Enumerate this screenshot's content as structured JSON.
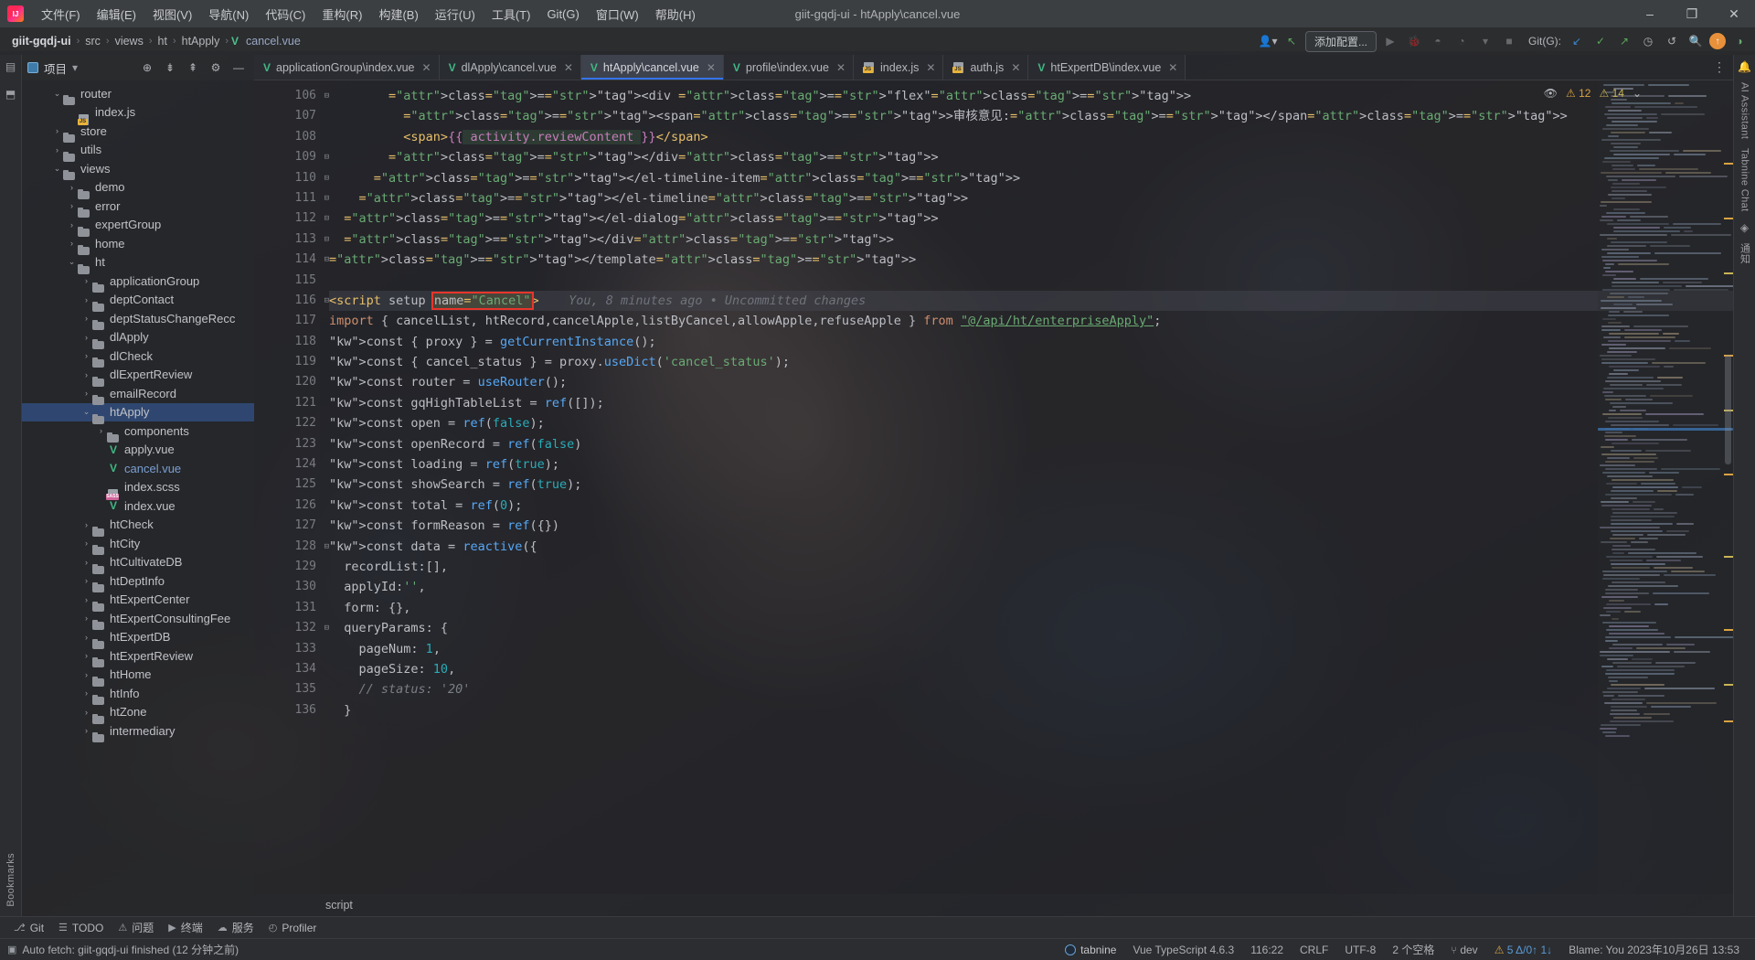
{
  "window": {
    "title": "giit-gqdj-ui - htApply\\cancel.vue",
    "minimize": "–",
    "maximize": "❐",
    "close": "✕"
  },
  "menu": [
    {
      "label": "文件(F)"
    },
    {
      "label": "编辑(E)"
    },
    {
      "label": "视图(V)"
    },
    {
      "label": "导航(N)"
    },
    {
      "label": "代码(C)"
    },
    {
      "label": "重构(R)"
    },
    {
      "label": "构建(B)"
    },
    {
      "label": "运行(U)"
    },
    {
      "label": "工具(T)"
    },
    {
      "label": "Git(G)"
    },
    {
      "label": "窗口(W)"
    },
    {
      "label": "帮助(H)"
    }
  ],
  "breadcrumbs": {
    "items": [
      "giit-gqdj-ui",
      "src",
      "views",
      "ht",
      "htApply"
    ],
    "file": "cancel.vue",
    "separator": "›"
  },
  "toolbar": {
    "run_config": "添加配置...",
    "git_label": "Git(G):",
    "profiler_dropdown": "▾"
  },
  "project_panel": {
    "title": "项目",
    "dropdown": "▾",
    "tree": [
      {
        "depth": 2,
        "arrow": "v",
        "type": "folder",
        "label": "router",
        "state": "normal"
      },
      {
        "depth": 3,
        "arrow": "",
        "type": "js",
        "label": "index.js",
        "state": "normal"
      },
      {
        "depth": 2,
        "arrow": ">",
        "type": "folder",
        "label": "store",
        "state": "normal"
      },
      {
        "depth": 2,
        "arrow": ">",
        "type": "folder",
        "label": "utils",
        "state": "normal"
      },
      {
        "depth": 2,
        "arrow": "v",
        "type": "folder",
        "label": "views",
        "state": "normal"
      },
      {
        "depth": 3,
        "arrow": ">",
        "type": "folder",
        "label": "demo",
        "state": "normal"
      },
      {
        "depth": 3,
        "arrow": ">",
        "type": "folder",
        "label": "error",
        "state": "normal"
      },
      {
        "depth": 3,
        "arrow": ">",
        "type": "folder",
        "label": "expertGroup",
        "state": "normal"
      },
      {
        "depth": 3,
        "arrow": ">",
        "type": "folder",
        "label": "home",
        "state": "normal"
      },
      {
        "depth": 3,
        "arrow": "v",
        "type": "folder",
        "label": "ht",
        "state": "normal"
      },
      {
        "depth": 4,
        "arrow": ">",
        "type": "folder",
        "label": "applicationGroup",
        "state": "normal"
      },
      {
        "depth": 4,
        "arrow": ">",
        "type": "folder",
        "label": "deptContact",
        "state": "normal"
      },
      {
        "depth": 4,
        "arrow": ">",
        "type": "folder",
        "label": "deptStatusChangeRecc",
        "state": "normal"
      },
      {
        "depth": 4,
        "arrow": ">",
        "type": "folder",
        "label": "dlApply",
        "state": "normal"
      },
      {
        "depth": 4,
        "arrow": ">",
        "type": "folder",
        "label": "dlCheck",
        "state": "normal"
      },
      {
        "depth": 4,
        "arrow": ">",
        "type": "folder",
        "label": "dlExpertReview",
        "state": "normal"
      },
      {
        "depth": 4,
        "arrow": ">",
        "type": "folder",
        "label": "emailRecord",
        "state": "normal"
      },
      {
        "depth": 4,
        "arrow": "v",
        "type": "folder",
        "label": "htApply",
        "state": "selected"
      },
      {
        "depth": 5,
        "arrow": ">",
        "type": "folder",
        "label": "components",
        "state": "normal"
      },
      {
        "depth": 5,
        "arrow": "",
        "type": "vue",
        "label": "apply.vue",
        "state": "normal"
      },
      {
        "depth": 5,
        "arrow": "",
        "type": "vue",
        "label": "cancel.vue",
        "state": "open"
      },
      {
        "depth": 5,
        "arrow": "",
        "type": "scss",
        "label": "index.scss",
        "state": "normal"
      },
      {
        "depth": 5,
        "arrow": "",
        "type": "vue",
        "label": "index.vue",
        "state": "normal"
      },
      {
        "depth": 4,
        "arrow": ">",
        "type": "folder",
        "label": "htCheck",
        "state": "normal"
      },
      {
        "depth": 4,
        "arrow": ">",
        "type": "folder",
        "label": "htCity",
        "state": "normal"
      },
      {
        "depth": 4,
        "arrow": ">",
        "type": "folder",
        "label": "htCultivateDB",
        "state": "normal"
      },
      {
        "depth": 4,
        "arrow": ">",
        "type": "folder",
        "label": "htDeptInfo",
        "state": "normal"
      },
      {
        "depth": 4,
        "arrow": ">",
        "type": "folder",
        "label": "htExpertCenter",
        "state": "normal"
      },
      {
        "depth": 4,
        "arrow": ">",
        "type": "folder",
        "label": "htExpertConsultingFee",
        "state": "normal"
      },
      {
        "depth": 4,
        "arrow": ">",
        "type": "folder",
        "label": "htExpertDB",
        "state": "normal"
      },
      {
        "depth": 4,
        "arrow": ">",
        "type": "folder",
        "label": "htExpertReview",
        "state": "normal"
      },
      {
        "depth": 4,
        "arrow": ">",
        "type": "folder",
        "label": "htHome",
        "state": "normal"
      },
      {
        "depth": 4,
        "arrow": ">",
        "type": "folder",
        "label": "htInfo",
        "state": "normal"
      },
      {
        "depth": 4,
        "arrow": ">",
        "type": "folder",
        "label": "htZone",
        "state": "normal"
      },
      {
        "depth": 4,
        "arrow": ">",
        "type": "folder",
        "label": "intermediary",
        "state": "normal"
      }
    ]
  },
  "left_strip": {
    "bookmarks_label": "Bookmarks"
  },
  "right_strip": {
    "ai_label": "AI Assistant",
    "tabnine_label": "Tabnine Chat",
    "notif_label": "通知"
  },
  "tabs": [
    {
      "label": "applicationGroup\\index.vue",
      "icon": "vue",
      "active": false
    },
    {
      "label": "dlApply\\cancel.vue",
      "icon": "vue",
      "active": false
    },
    {
      "label": "htApply\\cancel.vue",
      "icon": "vue",
      "active": true
    },
    {
      "label": "profile\\index.vue",
      "icon": "vue",
      "active": false
    },
    {
      "label": "index.js",
      "icon": "js",
      "active": false
    },
    {
      "label": "auth.js",
      "icon": "js",
      "active": false
    },
    {
      "label": "htExpertDB\\index.vue",
      "icon": "vue",
      "active": false
    }
  ],
  "inspections": {
    "eye": "👁",
    "warning_count": "12",
    "weak_count": "14",
    "collapse": "⌄"
  },
  "editor": {
    "first_line": 106,
    "current_line": 116,
    "blame_text": "You, 8 minutes ago • Uncommitted changes",
    "annotation_target": "name=\"Cancel\"",
    "footer_breadcrumb": "script",
    "lines": [
      {
        "n": 106,
        "fold": "⊟",
        "text": "        <div class=\"flex\">"
      },
      {
        "n": 107,
        "fold": "",
        "text": "          <span>审核意见:</span>"
      },
      {
        "n": 108,
        "fold": "",
        "text": "          <span>{{ activity.reviewContent }}</span>"
      },
      {
        "n": 109,
        "fold": "⊟",
        "text": "        </div>"
      },
      {
        "n": 110,
        "fold": "⊟",
        "text": "      </el-timeline-item>"
      },
      {
        "n": 111,
        "fold": "⊟",
        "text": "    </el-timeline>"
      },
      {
        "n": 112,
        "fold": "⊟",
        "text": "  </el-dialog>"
      },
      {
        "n": 113,
        "fold": "⊟",
        "text": "  </div>"
      },
      {
        "n": 114,
        "fold": "⊟",
        "text": "</template>"
      },
      {
        "n": 115,
        "fold": "",
        "text": ""
      },
      {
        "n": 116,
        "fold": "⊟",
        "text": "<script setup name=\"Cancel\">"
      },
      {
        "n": 117,
        "fold": "",
        "text": "import { cancelList, htRecord,cancelApple,listByCancel,allowApple,refuseApple } from \"@/api/ht/enterpriseApply\";"
      },
      {
        "n": 118,
        "fold": "",
        "text": "const { proxy } = getCurrentInstance();"
      },
      {
        "n": 119,
        "fold": "",
        "text": "const { cancel_status } = proxy.useDict('cancel_status');"
      },
      {
        "n": 120,
        "fold": "",
        "text": "const router = useRouter();"
      },
      {
        "n": 121,
        "fold": "",
        "text": "const gqHighTableList = ref([]);"
      },
      {
        "n": 122,
        "fold": "",
        "text": "const open = ref(false);"
      },
      {
        "n": 123,
        "fold": "",
        "text": "const openRecord = ref(false)"
      },
      {
        "n": 124,
        "fold": "",
        "text": "const loading = ref(true);"
      },
      {
        "n": 125,
        "fold": "",
        "text": "const showSearch = ref(true);"
      },
      {
        "n": 126,
        "fold": "",
        "text": "const total = ref(0);"
      },
      {
        "n": 127,
        "fold": "",
        "text": "const formReason = ref({})"
      },
      {
        "n": 128,
        "fold": "⊟",
        "text": "const data = reactive({"
      },
      {
        "n": 129,
        "fold": "",
        "text": "  recordList:[],"
      },
      {
        "n": 130,
        "fold": "",
        "text": "  applyId:'',"
      },
      {
        "n": 131,
        "fold": "",
        "text": "  form: {},"
      },
      {
        "n": 132,
        "fold": "⊟",
        "text": "  queryParams: {"
      },
      {
        "n": 133,
        "fold": "",
        "text": "    pageNum: 1,"
      },
      {
        "n": 134,
        "fold": "",
        "text": "    pageSize: 10,"
      },
      {
        "n": 135,
        "fold": "",
        "text": "    // status: '20'"
      },
      {
        "n": 136,
        "fold": "",
        "text": "  }"
      }
    ]
  },
  "tool_windows": [
    {
      "label": "Git",
      "icon": "git-icon"
    },
    {
      "label": "TODO",
      "icon": "todo-icon"
    },
    {
      "label": "问题",
      "icon": "problems-icon"
    },
    {
      "label": "终端",
      "icon": "terminal-icon"
    },
    {
      "label": "服务",
      "icon": "services-icon"
    },
    {
      "label": "Profiler",
      "icon": "profiler-icon"
    }
  ],
  "statusbar": {
    "message": "Auto fetch: giit-gqdj-ui finished (12 分钟之前)",
    "tabnine": "tabnine",
    "framework": "Vue TypeScript 4.6.3",
    "caret": "116:22",
    "line_sep": "CRLF",
    "encoding": "UTF-8",
    "indent": "2 个空格",
    "branch": "dev",
    "problems": "5 Δ/0↑ 1↓",
    "blame": "Blame: You 2023年10月26日 13:53"
  },
  "colors": {
    "accent": "#3574f0",
    "vue_green": "#41b883",
    "annotation_red": "#e8352b",
    "selection_blue": "#2f4770",
    "warning": "#d9a343"
  }
}
